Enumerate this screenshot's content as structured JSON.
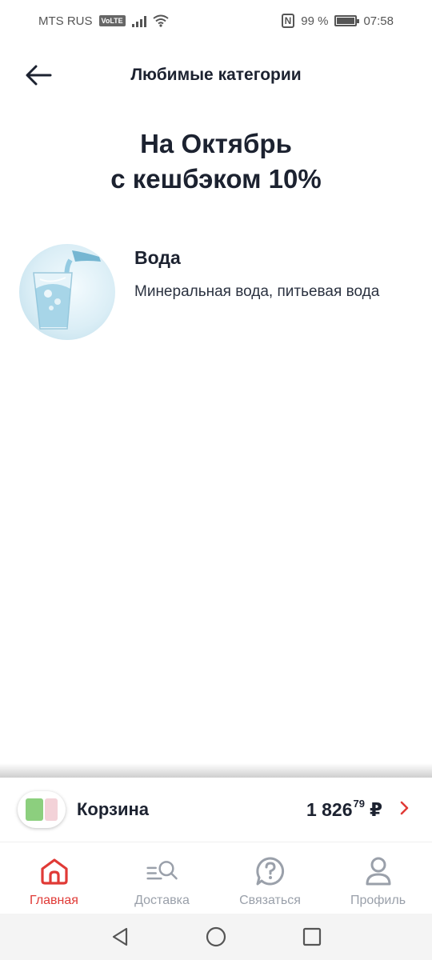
{
  "status_bar": {
    "carrier": "MTS RUS",
    "volte": "VoLTE",
    "nfc": "N",
    "battery": "99 %",
    "time": "07:58"
  },
  "header": {
    "title": "Любимые категории"
  },
  "headline": {
    "line1": "На Октябрь",
    "line2": "с кешбэком 10%"
  },
  "category": {
    "title": "Вода",
    "description": "Минеральная вода, питьевая вода"
  },
  "cart": {
    "label": "Корзина",
    "price_main": "1 826",
    "price_kop": "79",
    "currency": "₽"
  },
  "tabs": [
    {
      "label": "Главная",
      "icon": "home-icon",
      "active": true
    },
    {
      "label": "Доставка",
      "icon": "delivery-search-icon",
      "active": false
    },
    {
      "label": "Связаться",
      "icon": "help-chat-icon",
      "active": false
    },
    {
      "label": "Профиль",
      "icon": "profile-icon",
      "active": false
    }
  ],
  "colors": {
    "accent": "#e03a36",
    "text": "#1c2230",
    "inactive": "#9aa0aa"
  }
}
